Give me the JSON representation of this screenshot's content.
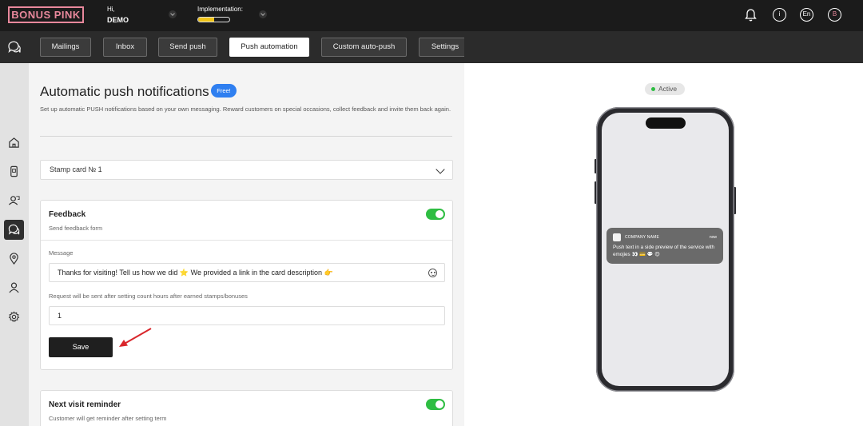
{
  "header": {
    "logo": "BONUS PINK",
    "greeting": "Hi,",
    "user_name": "DEMO",
    "implementation_label": "Implementation:",
    "implementation_progress": 0.5,
    "info_icon": "i",
    "lang": "En",
    "avatar_letter": "B"
  },
  "nav": {
    "tabs": [
      {
        "label": "Mailings"
      },
      {
        "label": "Inbox"
      },
      {
        "label": "Send push"
      },
      {
        "label": "Push automation",
        "active": true
      },
      {
        "label": "Custom auto-push"
      },
      {
        "label": "Settings"
      }
    ]
  },
  "sidebar": {
    "items": [
      "home-icon",
      "phone-card-icon",
      "users-chat-icon",
      "chat-icon",
      "location-icon",
      "user-icon",
      "gear-icon"
    ],
    "active_index": 3
  },
  "page": {
    "title": "Automatic push notifications",
    "badge": "Free!",
    "subtitle": "Set up automatic PUSH notifications based on your own messaging. Reward customers on special occasions, collect feedback and invite them back again.",
    "card_select": "Stamp card № 1"
  },
  "feedback": {
    "title": "Feedback",
    "subtitle": "Send feedback form",
    "enabled": true,
    "message_label": "Message",
    "message_value": "Thanks for visiting! Tell us how we did ⭐ We provided a link in the card description 👉",
    "delay_label": "Request will be sent after setting count hours after earned stamps/bonuses",
    "delay_value": "1",
    "save_label": "Save"
  },
  "reminder": {
    "title": "Next visit reminder",
    "subtitle": "Customer will get reminder after setting term",
    "enabled": true
  },
  "preview": {
    "status": "Active",
    "company": "COMPANY NAME",
    "time": "now",
    "text": "Push text in a side preview of the service with emojies 👀 💳 💬 😍"
  },
  "colors": {
    "accent_pink": "#e8889c",
    "toggle_green": "#2ebd42",
    "badge_blue": "#2f7ff0",
    "progress_yellow": "#f0c419",
    "annotation_red": "#d9262b"
  }
}
